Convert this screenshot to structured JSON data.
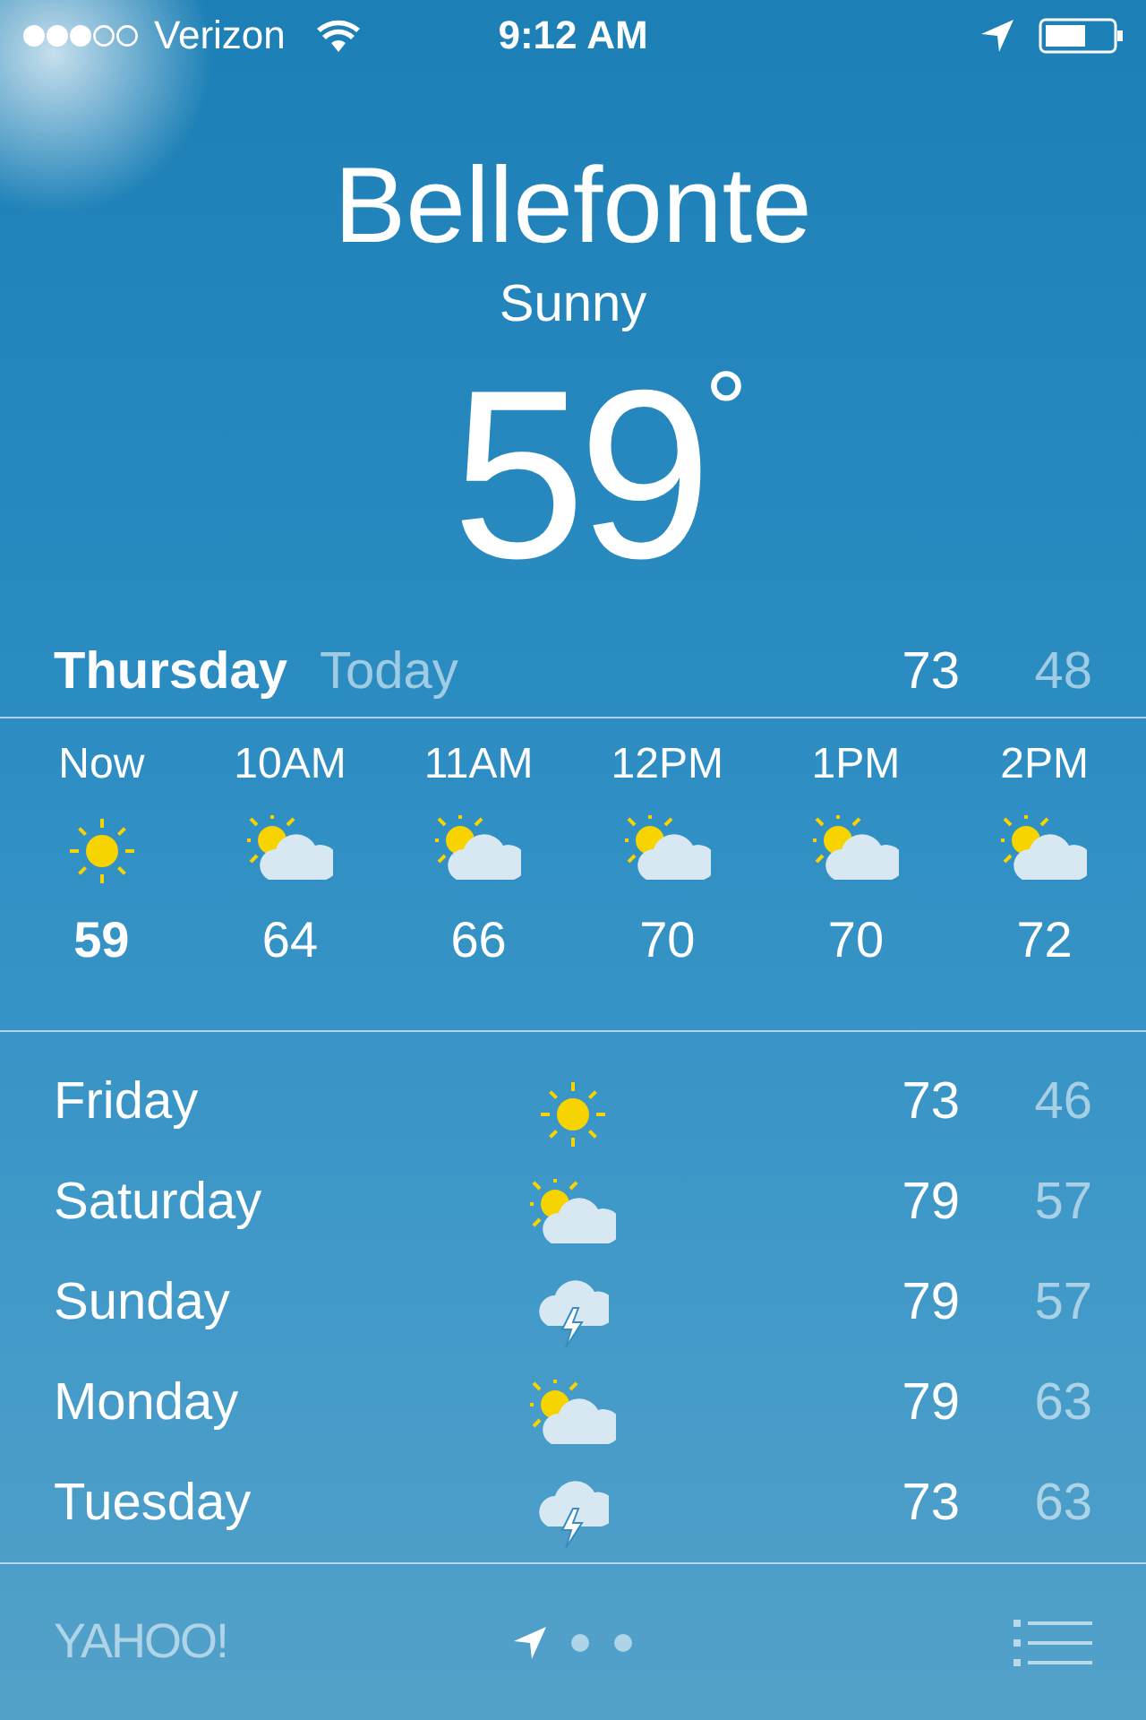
{
  "status_bar": {
    "carrier": "Verizon",
    "time": "9:12 AM"
  },
  "location": {
    "city": "Bellefonte",
    "condition": "Sunny",
    "temperature": "59",
    "degree": "°"
  },
  "today": {
    "day": "Thursday",
    "label": "Today",
    "high": "73",
    "low": "48"
  },
  "hourly": [
    {
      "time": "Now",
      "kind": "sunny",
      "temp": "59",
      "current": true
    },
    {
      "time": "10AM",
      "kind": "partly_cloudy",
      "temp": "64",
      "current": false
    },
    {
      "time": "11AM",
      "kind": "partly_cloudy",
      "temp": "66",
      "current": false
    },
    {
      "time": "12PM",
      "kind": "partly_cloudy",
      "temp": "70",
      "current": false
    },
    {
      "time": "1PM",
      "kind": "partly_cloudy",
      "temp": "70",
      "current": false
    },
    {
      "time": "2PM",
      "kind": "partly_cloudy",
      "temp": "72",
      "current": false
    }
  ],
  "daily": [
    {
      "day": "Friday",
      "kind": "sunny",
      "high": "73",
      "low": "46"
    },
    {
      "day": "Saturday",
      "kind": "partly_cloudy",
      "high": "79",
      "low": "57"
    },
    {
      "day": "Sunday",
      "kind": "storm",
      "high": "79",
      "low": "57"
    },
    {
      "day": "Monday",
      "kind": "partly_cloudy",
      "high": "79",
      "low": "63"
    },
    {
      "day": "Tuesday",
      "kind": "storm",
      "high": "73",
      "low": "63"
    }
  ],
  "footer": {
    "logo": "YAHOO!"
  }
}
